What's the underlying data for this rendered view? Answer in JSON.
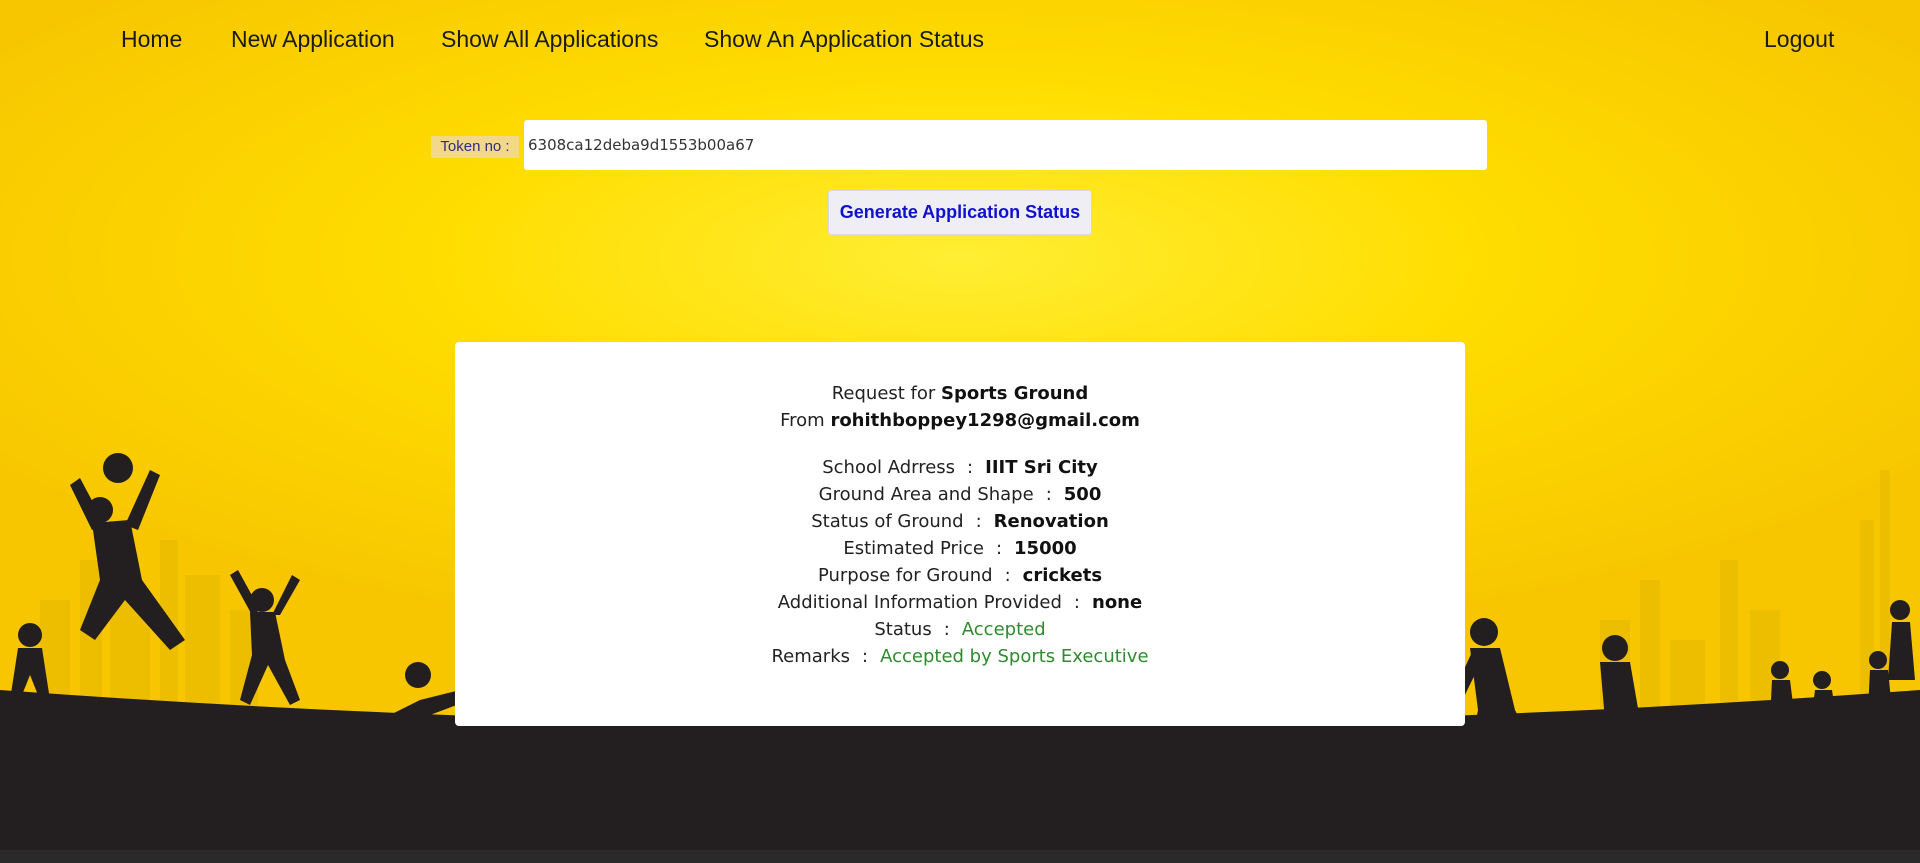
{
  "nav": {
    "home": "Home",
    "new_application": "New Application",
    "show_all_applications": "Show All Applications",
    "show_application_status": "Show An Application Status",
    "logout": "Logout"
  },
  "token": {
    "label": "Token no :",
    "value": "6308ca12deba9d1553b00a67"
  },
  "generate_button": "Generate Application Status",
  "result": {
    "request_prefix": "Request for",
    "request_type": "Sports Ground",
    "from_prefix": "From",
    "from_email": "rohithboppey1298@gmail.com",
    "separator": ":",
    "fields": [
      {
        "label": "School Adrress",
        "value": "IIIT Sri City"
      },
      {
        "label": "Ground Area and Shape",
        "value": "500"
      },
      {
        "label": "Status of Ground",
        "value": "Renovation"
      },
      {
        "label": "Estimated Price",
        "value": "15000"
      },
      {
        "label": "Purpose for Ground",
        "value": "crickets"
      },
      {
        "label": "Additional Information Provided",
        "value": "none"
      }
    ],
    "status_label": "Status",
    "status_value": "Accepted",
    "remarks_label": "Remarks",
    "remarks_value": "Accepted by Sports Executive"
  },
  "colors": {
    "background": "#ffdd00",
    "silhouette": "#231f20",
    "button_text": "#1111cc",
    "accepted_green": "#2e8b2e"
  }
}
